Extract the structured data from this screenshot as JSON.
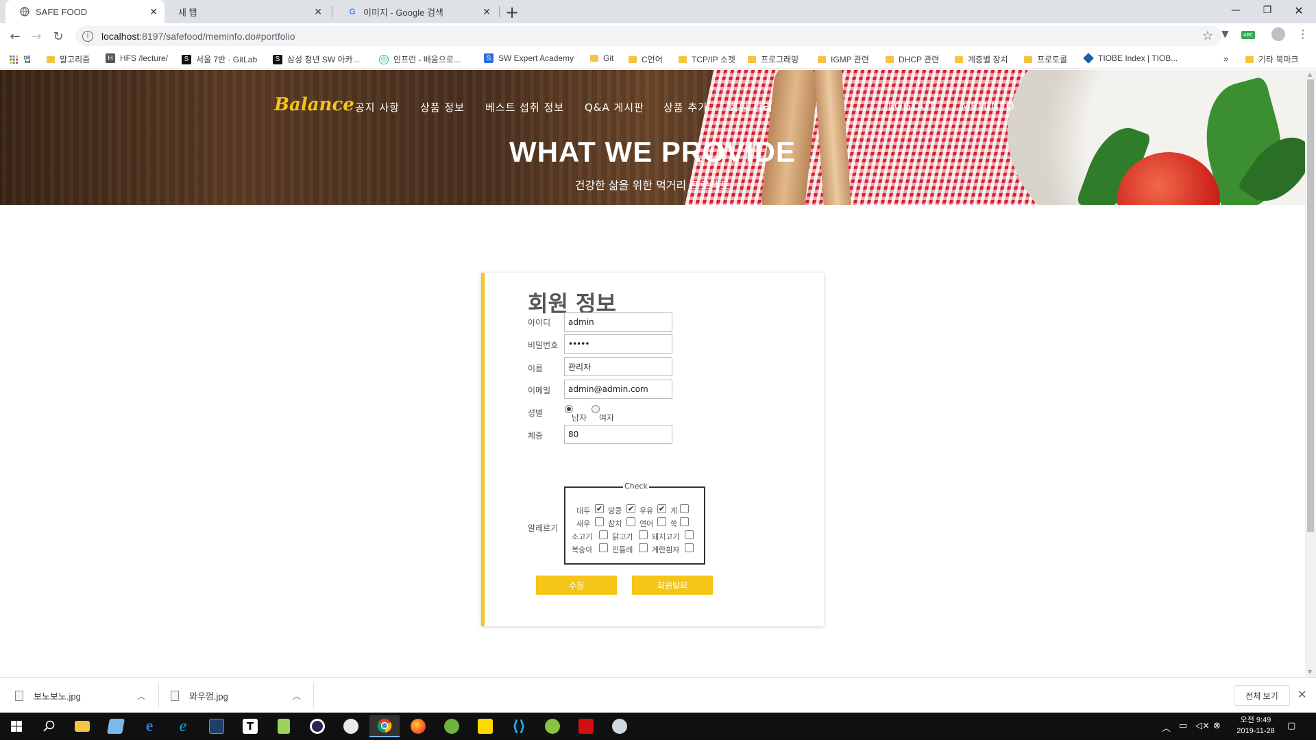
{
  "browser": {
    "tabs": [
      {
        "title": "SAFE FOOD",
        "active": true
      },
      {
        "title": "새 탭",
        "active": false
      },
      {
        "title": "이미지 - Google 검색",
        "active": false
      }
    ],
    "url_host": "localhost",
    "url_path": ":8197/safefood/meminfo.do#portfolio",
    "bookmarks": [
      {
        "label": "앱",
        "icon": "apps-grid-icon"
      },
      {
        "label": "알고리즘",
        "icon": "folder-icon"
      },
      {
        "label": "HFS /lecture/",
        "icon": "hfs-icon"
      },
      {
        "label": "서울 7반 · GitLab",
        "icon": "gitlab-icon"
      },
      {
        "label": "삼성 청년 SW 아카...",
        "icon": "ssafy-icon"
      },
      {
        "label": "인프런 - 배움으로...",
        "icon": "inflearn-icon"
      },
      {
        "label": "SW Expert Academy",
        "icon": "swea-icon"
      },
      {
        "label": "Git",
        "icon": "folder-icon"
      },
      {
        "label": "C언어",
        "icon": "folder-icon"
      },
      {
        "label": "TCP/IP 소켓",
        "icon": "folder-icon"
      },
      {
        "label": "프로그래밍",
        "icon": "folder-icon"
      },
      {
        "label": "IGMP 관련",
        "icon": "folder-icon"
      },
      {
        "label": "DHCP 관련",
        "icon": "folder-icon"
      },
      {
        "label": "계층별 장치",
        "icon": "folder-icon"
      },
      {
        "label": "프로토콜",
        "icon": "folder-icon"
      },
      {
        "label": "TIOBE Index | TIOB...",
        "icon": "tiobe-icon"
      }
    ],
    "other_bookmarks": "기타 북마크",
    "more": "»"
  },
  "site": {
    "brand": "Balance",
    "menu": [
      "공지 사항",
      "상품 정보",
      "베스트 섭취 정보",
      "Q&A 게시판",
      "상품 추가",
      "회원 관리"
    ],
    "menu_right": [
      "LOGOUT",
      "MEMINFO"
    ],
    "hero_title": "WHAT WE PROVIDE",
    "hero_subtitle": "건강한 삶을 위한 먹거리 프로젝트"
  },
  "form": {
    "title": "회원 정보",
    "id_label": "아이디",
    "id_value": "admin",
    "password_label": "비밀번호",
    "password_value": "•••••",
    "name_label": "이름",
    "name_value": "관리자",
    "email_label": "이메일",
    "email_value": "admin@admin.com",
    "gender_label": "성별",
    "gender_options": [
      {
        "label": "남자",
        "checked": true
      },
      {
        "label": "여자",
        "checked": false
      }
    ],
    "weight_label": "체중",
    "weight_value": "80",
    "allergy_label": "알레르기",
    "allergy_legend": "Check",
    "allergies": [
      {
        "label": "대두",
        "checked": true
      },
      {
        "label": "땅콩",
        "checked": true
      },
      {
        "label": "우유",
        "checked": true
      },
      {
        "label": "게",
        "checked": false
      },
      {
        "label": "새우",
        "checked": false
      },
      {
        "label": "참치",
        "checked": false
      },
      {
        "label": "연어",
        "checked": false
      },
      {
        "label": "쑥",
        "checked": false
      },
      {
        "label": "소고기",
        "checked": false
      },
      {
        "label": "닭고기",
        "checked": false
      },
      {
        "label": "돼지고기",
        "checked": false
      },
      {
        "label": "복숭아",
        "checked": false
      },
      {
        "label": "민들레",
        "checked": false
      },
      {
        "label": "계란흰자",
        "checked": false
      }
    ],
    "update_button": "수정",
    "withdraw_button": "회원탈퇴"
  },
  "downloads": [
    {
      "filename": "보노보노.jpg"
    },
    {
      "filename": "와우껌.jpg"
    }
  ],
  "downloads_show_all": "전체 보기",
  "taskbar": {
    "clock_time": "오전 9:49",
    "clock_date": "2019-11-28",
    "apps": [
      "start-icon",
      "search-icon",
      "file-explorer-icon",
      "notepad-icon",
      "edge-icon",
      "ie-icon",
      "terminal-icon",
      "typora-icon",
      "notepad-plus-icon",
      "eclipse-icon",
      "paint-icon",
      "chrome-icon",
      "firefox-icon",
      "spring-icon",
      "sticky-notes-icon",
      "vscode-icon",
      "spring-tool-icon",
      "acrobat-icon",
      "snipping-tool-icon"
    ]
  },
  "colors": {
    "accent": "#f5c518",
    "chrome_tabbar": "#dee1e6",
    "taskbar": "#101010"
  }
}
